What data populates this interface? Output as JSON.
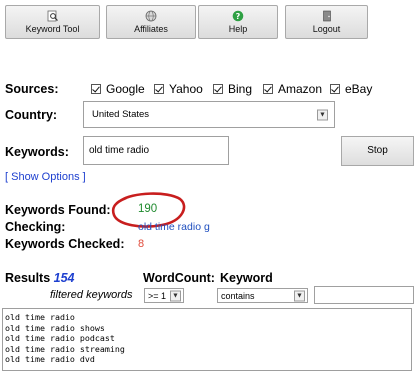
{
  "toolbar": {
    "buttons": [
      {
        "label": "Keyword Tool",
        "icon": "magnifier-icon"
      },
      {
        "label": "Affiliates",
        "icon": "globe-icon"
      },
      {
        "label": "Help",
        "icon": "help-icon"
      },
      {
        "label": "Logout",
        "icon": "door-icon"
      }
    ]
  },
  "sources": {
    "label": "Sources:",
    "items": [
      "Google",
      "Yahoo",
      "Bing",
      "Amazon",
      "eBay"
    ]
  },
  "country": {
    "label": "Country:",
    "value": "United States"
  },
  "keywords": {
    "label": "Keywords:",
    "value": "old time radio"
  },
  "stop_label": "Stop",
  "show_options": "[ Show Options ]",
  "status": {
    "found_label": "Keywords Found:",
    "found_value": "190",
    "checking_label": "Checking:",
    "checking_value": "old time radio g",
    "checked_label": "Keywords Checked:",
    "checked_value": "8"
  },
  "results": {
    "label": "Results",
    "count": "154",
    "filtered_label": "filtered keywords",
    "wordcount_label": "WordCount:",
    "wordcount_value": ">= 1",
    "keyword_label": "Keyword",
    "keyword_filter": "contains",
    "keyword_filter_value": ""
  },
  "result_lines": [
    "old time radio",
    "old time radio shows",
    "old time radio podcast",
    "old time radio streaming",
    "old time radio dvd"
  ],
  "colors": {
    "found": "#1f8a2e",
    "checking": "#1f4fbf",
    "checked": "#e04a3a",
    "link": "#1d3fcf",
    "circle": "#c81e1e"
  }
}
